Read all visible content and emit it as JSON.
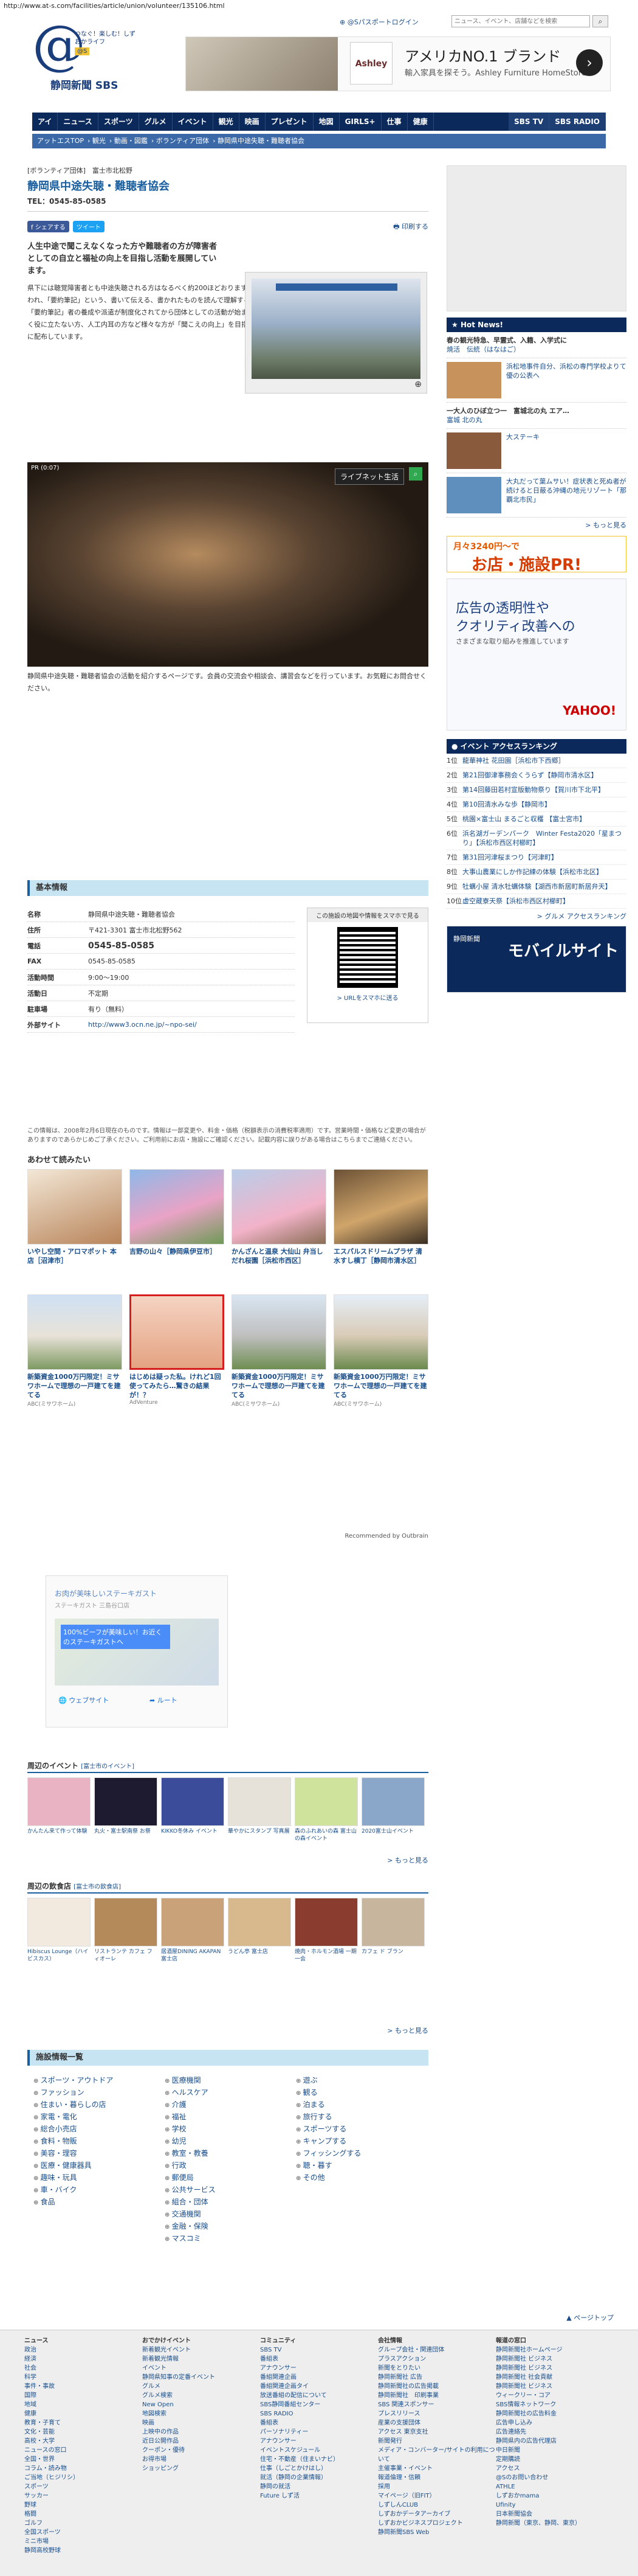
{
  "url": "http://www.at-s.com/facilities/article/union/volunteer/135106.html",
  "header": {
    "logo_tagline": "つなぐ！楽しむ！しずおかライフ",
    "logo_badge": "@S",
    "logo_name": "静岡新聞 SBS",
    "top_links": [
      "⊕ @Sパスポートログイン"
    ],
    "search_placeholder": "ニュース、イベント、店舗などを検索",
    "ad": {
      "title": "アメリカNO.1 ブランド",
      "subtitle": "輸入家具を探そう。Ashley Furniture HomeStoreで",
      "logo": "Ashley"
    }
  },
  "nav": [
    "アイ",
    "ニュース",
    "スポーツ",
    "グルメ",
    "イベント",
    "観光",
    "映画",
    "プレゼント",
    "地図",
    "GIRLS+",
    "仕事",
    "健康",
    "SBS TV",
    "SBS RADIO"
  ],
  "breadcrumb": [
    "アットエスTOP",
    "観光",
    "動画・図鑑",
    "ボランティア団体",
    "静岡県中途失聴・難聴者協会"
  ],
  "article": {
    "category": "[ボランティア団体]　富士市北松野",
    "title": "静岡県中途失聴・難聴者協会",
    "tel": "TEL：0545-85-0585",
    "share_fb": "f シェアする",
    "share_tw": "ツイート",
    "print": "印刷する",
    "lead": "人生中途で聞こえなくなった方や難聴者の方が障害者としての自立と福祉の向上を目指し活動を展開しています。",
    "body": "県下には聴覚障害者とも中途失聴される方はなるべく約200ほどおります。手話をコミュニケーションの手段とする方は約2割程と言われ、「要約筆記」という、書いて伝える、書かれたものを読んで理解する私たちの集団は障害者運動の中でも遅くに生まれました。「要約筆記」者の養成や派遣が制度化されてから団体としての活動が始まりました。会員の数は、年々増えておりますが、難聴者が全く役に立たない方、人工内耳の方など様々な方が「聞こえの向上」を目指して活動しています。月1回発行の機関誌は「静難協」会員に配布しています。",
    "video_ad": "PR (0:07)",
    "video_badge": "ライブネット生活",
    "after": "静岡県中途失聴・難聴者協会の活動を紹介するページです。会員の交流会や相談会、講習会などを行っています。お気軽にお問合せください。"
  },
  "info": {
    "title": "基本情報",
    "rows": [
      {
        "k": "名称",
        "v": "静岡県中途失聴・難聴者協会"
      },
      {
        "k": "住所",
        "v": "〒421-3301 富士市北松野562"
      },
      {
        "k": "電話",
        "v": "0545-85-0585"
      },
      {
        "k": "FAX",
        "v": "0545-85-0585"
      },
      {
        "k": "活動時間",
        "v": "9:00〜19:00"
      },
      {
        "k": "活動日",
        "v": "不定期"
      },
      {
        "k": "駐車場",
        "v": "有り（無料）"
      },
      {
        "k": "外部サイト",
        "v": "http://www3.ocn.ne.jp/~npo-sei/"
      }
    ],
    "qr_title": "この施設の地図や情報をスマホで見る",
    "qr_link": "> URLをスマホに送る",
    "note": "この情報は、2008年2月6日現在のものです。情報は一部変更や、料金・価格（税額表示の消費税率適用）です。営業時間・価格など変更の場合がありますのであらかじめご了承ください。ご利用前にお店・施設にご確認ください。記載内容に誤りがある場合はこちらまでご連絡ください。"
  },
  "recommend": {
    "title": "あわせて読みたい",
    "row1": [
      {
        "cap": "いやし空間・アロマポット 本店［沼津市］",
        "src": ""
      },
      {
        "cap": "吉野の山々［静岡県伊豆市］",
        "src": ""
      },
      {
        "cap": "かんざんと温泉 大仙山 弁当しだれ桜園［浜松市西区］",
        "src": ""
      },
      {
        "cap": "エスパルスドリームプラザ 清水すし横丁［静岡市清水区］",
        "src": ""
      }
    ],
    "row2": [
      {
        "cap": "新築資金1000万円限定！ミサワホームで理想の一戸建てを建てる",
        "src": "ABC(ミサワホーム)"
      },
      {
        "cap": "はじめは疑った私。けれど1回使ってみたら…驚きの結果が！？",
        "src": "AdVenture"
      },
      {
        "cap": "新築資金1000万円限定！ミサワホームで理想の一戸建てを建てる",
        "src": "ABC(ミサワホーム)"
      },
      {
        "cap": "新築資金1000万円限定！ミサワホームで理想の一戸建てを建てる",
        "src": "ABC(ミサワホーム)"
      }
    ],
    "recommended_by": "Recommended by Outbrain"
  },
  "map_ad": {
    "title": "お肉が美味しいステーキガスト",
    "sub": "ステーキガスト 三島谷口店",
    "promo": "100%ビーフが美味しい！お近くのステーキガストへ",
    "website": "ウェブサイト",
    "route": "ルート"
  },
  "events": {
    "title": "周辺のイベント",
    "area": "[富士市のイベント]",
    "items": [
      {
        "c": "かんたん来て作って体験"
      },
      {
        "c": "丸火・富士駅南祭 お祭"
      },
      {
        "c": "KIKKO冬休み イベント"
      },
      {
        "c": "華やかにスタンプ 写真展"
      },
      {
        "c": "森のふれあいの森 富士山の森イベント"
      },
      {
        "c": "2020富士山イベント"
      }
    ],
    "more": "> もっと見る"
  },
  "foods": {
    "title": "周辺の飲食店",
    "area": "[富士市の飲食店]",
    "items": [
      {
        "c": "Hibiscus Lounge（ハイビスカス）"
      },
      {
        "c": "リストランテ カフェ フィオーレ"
      },
      {
        "c": "居酒屋DINING AKAPAN 富士店"
      },
      {
        "c": "うどん亭 富士店"
      },
      {
        "c": "焼肉・ホルモン酒場 一期一会"
      },
      {
        "c": "カフェ ド ブラン"
      }
    ],
    "more": "> もっと見る"
  },
  "facilities": {
    "title": "施設情報一覧",
    "col1": [
      "スポーツ・アウトドア",
      "ファッション",
      "住まい・暮らしの店",
      "家電・電化",
      "総合小売店",
      "食料・物販",
      "美容・理容",
      "医療・健康器具",
      "趣味・玩具",
      "車・バイク",
      "食品"
    ],
    "col2": [
      "医療機関",
      "ヘルスケア",
      "介護",
      "福祉",
      "学校",
      "幼児",
      "教室・教養",
      "行政",
      "郵便局",
      "公共サービス",
      "組合・団体",
      "交通機関",
      "金融・保険",
      "マスコミ"
    ],
    "col3": [
      "遊ぶ",
      "観る",
      "泊まる",
      "旅行する",
      "スポーツする",
      "キャンプする",
      "フィッシングする",
      "聴・暮す",
      "その他"
    ]
  },
  "sidebar": {
    "hot_title": "Hot News!",
    "hot_first": "春の観光特急、早霊式、入籍、入学式に",
    "hot_first_sub": "焼活　伝統（はなはご）",
    "hot_items": [
      {
        "t": "浜松地事件自分、浜松の専門学校よりて優の公表へ"
      },
      {
        "t": "大ステーキ"
      },
      {
        "t": "大丸だって葉ムサい！症状表と死ぬ者が続けると日蔽る沖縄の地元リゾート「那覇北市民」"
      }
    ],
    "hot_text": "一大人のひぼ立つ一　富城北の丸 エア…",
    "hot_text_sub": "富城 北の丸",
    "more": "> もっと見る",
    "pr_line1": "月々3240円〜で",
    "pr_line2": "お店・施設PR!",
    "yahoo_1": "広告の透明性や",
    "yahoo_2": "クオリティ改善への",
    "yahoo_3": "さまざまな取り組みを推進しています",
    "yahoo_logo": "YAHOO!",
    "rank_title": "イベント アクセスランキング",
    "ranks": [
      {
        "n": "1位",
        "t": "龍華神社 花田園［浜松市下西郷］"
      },
      {
        "n": "2位",
        "t": "第21回御津事務会くうらず【静岡市清水区】"
      },
      {
        "n": "3位",
        "t": "第14回藤田若村宣版動物祭り【賀川市下北平】"
      },
      {
        "n": "4位",
        "t": "第10回清水みな歩【静岡市】"
      },
      {
        "n": "5位",
        "t": "桃園×富士山 まるごと収穫 【富士宮市】"
      },
      {
        "n": "6位",
        "t": "浜名湖ガーデンパーク　Winter Festa2020「星まつり」【浜松市西区村櫛町】"
      },
      {
        "n": "7位",
        "t": "第31回河津桜まつり【河津町】"
      },
      {
        "n": "8位",
        "t": "大事山農業にしか作記練の体験【浜松市北区】"
      },
      {
        "n": "9位",
        "t": "牡蠣小屋 清水牡蠣体験【湖西市新居町新居弁天】"
      },
      {
        "n": "10位",
        "t": "虚空蔵寮天祭【浜松市西区村櫛町】"
      }
    ],
    "rank_more": "> グルメ アクセスランキング",
    "mobile_small": "静岡新聞",
    "mobile_big": "モバイルサイト"
  },
  "pagetop": "▲ ページトップ",
  "footer": [
    {
      "h": "ニュース",
      "items": [
        "政治",
        "経済",
        "社会",
        "科学",
        "事件・事故",
        "国際",
        "地域",
        "健康",
        "教育・子育て",
        "文化・芸能",
        "高校・大学",
        "ニュースの窓口",
        "全国・世界",
        "コラム・読み物",
        "ご当地（ヒジリシ）",
        "スポーツ",
        "サッカー",
        "野球",
        "格闘",
        "ゴルフ",
        "全国スポーツ",
        "ミニ市場",
        "静岡高校野球"
      ]
    },
    {
      "h": "おでかけイベント",
      "items": [
        "新着観光イベント",
        "新着観光情報",
        "イベント",
        "静岡県知事の定番イベント",
        "グルメ",
        "グルメ検索",
        "New Open",
        "地図検索",
        "映画",
        "上映中の作品",
        "近日公開作品",
        "クーポン・優待",
        "お得市場",
        "ショッピング"
      ]
    },
    {
      "h": "コミュニティ",
      "items": [
        "SBS TV",
        "番組表",
        "アナウンサー",
        "番組関連企画",
        "番組関連企画タイ",
        "放送番組の配信について",
        "SBS静岡番組センター",
        "SBS RADIO",
        "番組表",
        "パーソナリティー",
        "アナウンサー",
        "イベントスケジュール",
        "住宅・不動産（住まいナビ）",
        "仕事（しごとかけはし）",
        "就活（静岡の企業情報）",
        "静岡の就活",
        "Future しず活"
      ]
    },
    {
      "h": "会社情報",
      "items": [
        "グループ会社・関連団体",
        "プラスアクション",
        "新聞をとりたい",
        "静岡新聞社 広告",
        "静岡新聞社の広告掲載",
        "静岡新聞社　印刷事業",
        "SBS 関連スポンサー",
        "プレスリリース",
        "産業の支援団体",
        "アクセス 東京支社",
        "新聞発行",
        "メディア・コンバーター/サイトの利用について",
        "主催事業・イベント",
        "報道倫理・信頼",
        "採用",
        "マイページ（旧FIT）",
        "しずしんCLUB",
        "しずおかデータアーカイブ",
        "しずおかビジネスプロジェクト",
        "静岡新聞SBS Web"
      ]
    },
    {
      "h": "報道の窓口",
      "items": [
        "静岡新聞社ホームページ",
        "静岡新聞社 ビジネス",
        "静岡新聞社 ビジネス",
        "静岡新聞社 社会貢献",
        "静岡新聞社 ビジネス",
        "ウィークリー・コア",
        "SBS情報ネットワーク",
        "静岡新聞社の広告料金",
        "広告申し込み",
        "広告連絡先",
        "静岡県内の広告代理店",
        "中日新聞",
        "定期購読",
        "アクセス",
        "@Sのお問い合わせ",
        "ATHLE",
        "しずおかmama",
        "Ufinity",
        "日本新聞協会",
        "静岡新聞（東京、静岡、東京）"
      ]
    }
  ]
}
